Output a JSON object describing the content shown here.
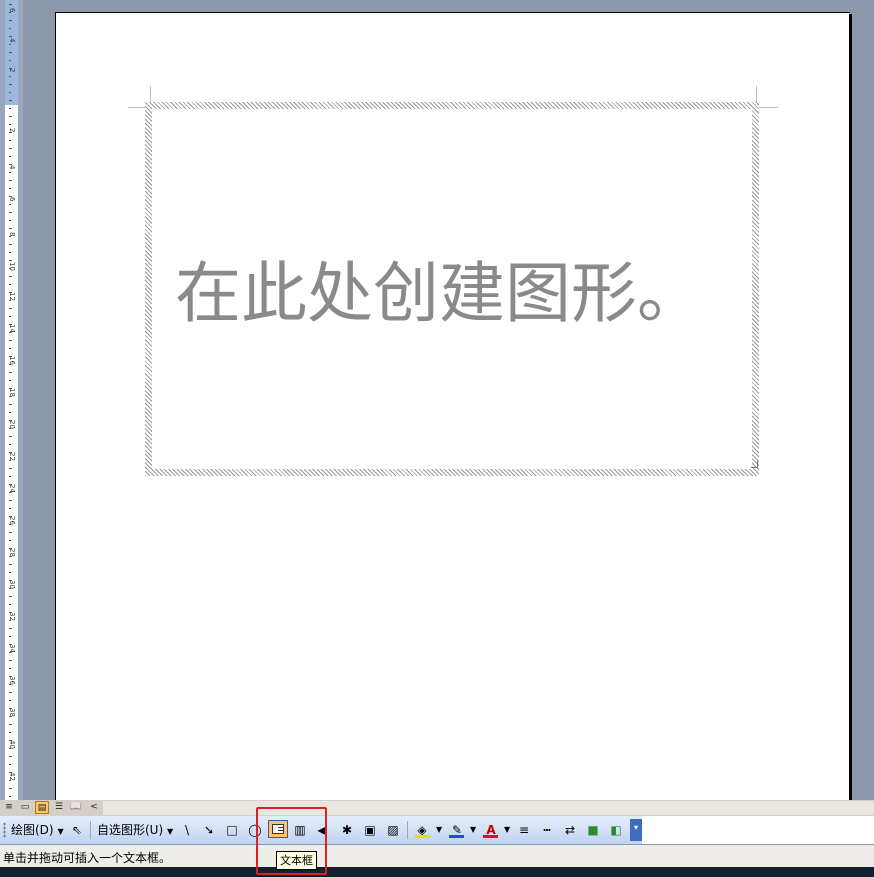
{
  "ruler": {
    "labels": [
      "6",
      "4",
      "2",
      "",
      "2",
      "4",
      "6",
      "8",
      "10",
      "12",
      "14",
      "16",
      "18",
      "20",
      "22",
      "24",
      "26",
      "28",
      "30",
      "32",
      "34",
      "36",
      "38",
      "40",
      "42"
    ]
  },
  "canvas": {
    "placeholder_text": "在此处创建图形。"
  },
  "view_bar": {
    "buttons": [
      {
        "name": "normal-view",
        "glyph": "≡"
      },
      {
        "name": "web-layout-view",
        "glyph": "▭"
      },
      {
        "name": "print-layout-view",
        "glyph": "▤"
      },
      {
        "name": "outline-view",
        "glyph": "☰"
      },
      {
        "name": "reading-view",
        "glyph": "📖"
      }
    ],
    "scroll_left_glyph": "<"
  },
  "toolbar": {
    "draw_label": "绘图(D)",
    "autoshapes_label": "自选图形(U)",
    "line_glyph": "\\",
    "arrow_glyph": "➘",
    "rect_glyph": "□",
    "oval_glyph": "◯",
    "vtextbox_glyph": "▥",
    "wordart_glyph": "◀",
    "diagram_glyph": "✱",
    "clipart_glyph": "▣",
    "picture_glyph": "▨",
    "fill_glyph": "◈",
    "linecolor_glyph": "✎",
    "fontcolor_glyph": "A",
    "linestyle_glyph": "≡",
    "dash_glyph": "┅",
    "arrowstyle_glyph": "⇄",
    "shadow_glyph": "■",
    "threed_glyph": "◧",
    "fill_color": "#ffd400",
    "line_color": "#1f4bd8",
    "font_color": "#e01010"
  },
  "tooltip": {
    "text": "文本框"
  },
  "status": {
    "text": "单击并拖动可插入一个文本框。"
  },
  "colors": {
    "highlight_border": "#e02020",
    "active_button": "#ffc169"
  }
}
